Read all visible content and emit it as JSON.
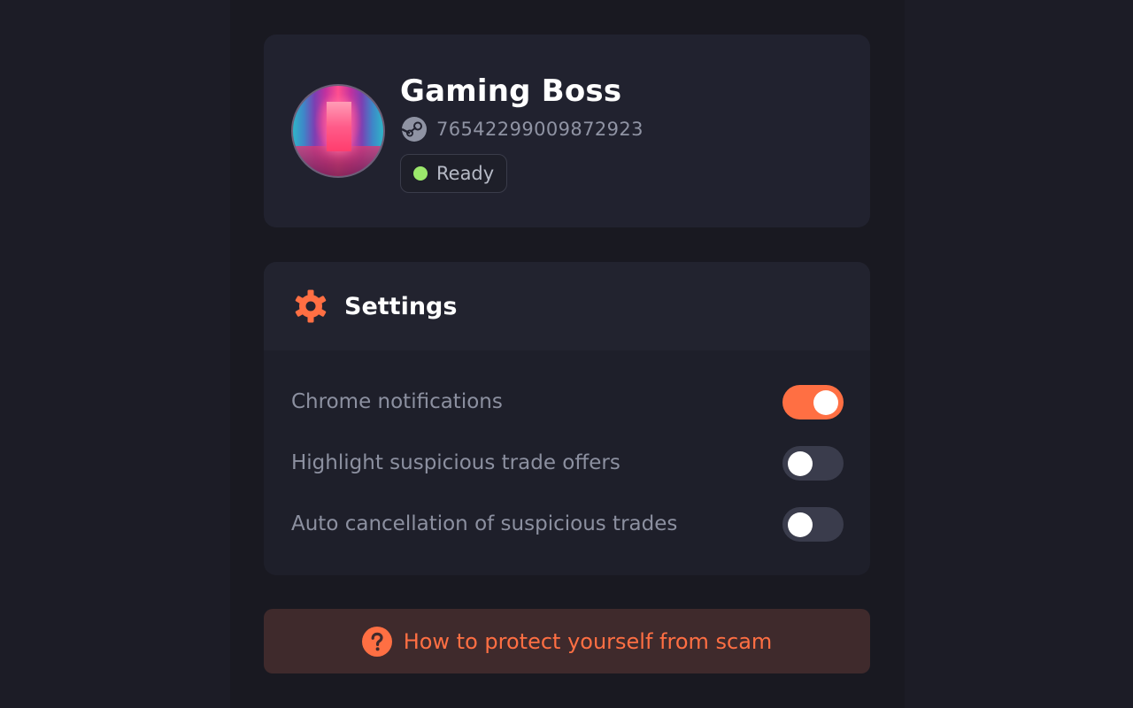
{
  "profile": {
    "name": "Gaming Boss",
    "steam_id": "76542299009872923",
    "status": "Ready",
    "status_color": "#9be86b",
    "avatar_icon": "avatar-image",
    "id_icon": "steam-icon"
  },
  "settings": {
    "title": "Settings",
    "icon": "gear-icon",
    "items": [
      {
        "label": "Chrome notifications",
        "enabled": true
      },
      {
        "label": "Highlight suspicious trade offers",
        "enabled": false
      },
      {
        "label": "Auto cancellation of suspicious trades",
        "enabled": false
      }
    ]
  },
  "help": {
    "label": "How to protect yourself from scam",
    "icon": "question-circle-icon"
  },
  "colors": {
    "accent": "#ff6f43",
    "background": "#1c1c26",
    "card": "#21222f",
    "toggle_off": "#3a3c4c"
  }
}
